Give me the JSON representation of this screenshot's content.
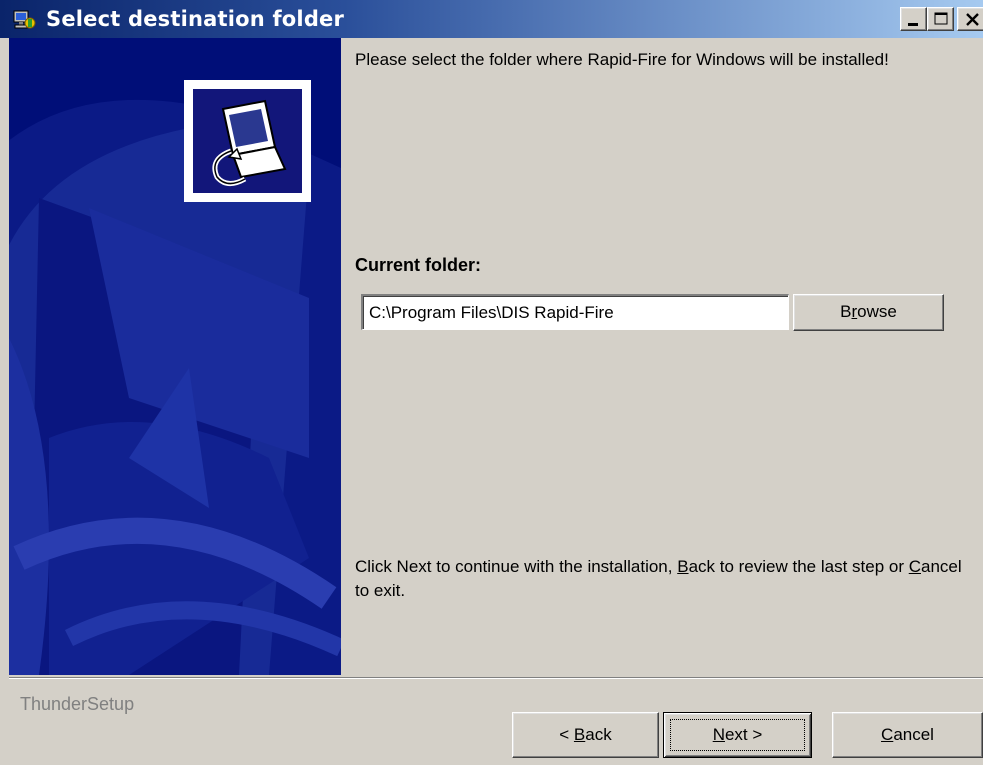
{
  "window": {
    "title": "Select destination folder",
    "title_icon": "installer-icon"
  },
  "caption_buttons": {
    "minimize": "minimize-icon",
    "maximize": "maximize-icon",
    "close": "close-icon"
  },
  "banner": {
    "logo_icon": "computer-setup-icon",
    "background": "#000e78"
  },
  "content": {
    "intro": "Please select the folder where Rapid-Fire for Windows will be installed!",
    "folder_label": "Current folder:",
    "folder_path": "C:\\Program Files\\DIS Rapid-Fire",
    "browse_label": {
      "pre": "B",
      "accel": "r",
      "post": "owse"
    },
    "footer": {
      "part1": "Click Next to continue with the installation, ",
      "back_accel": "B",
      "part2": "ack to review the last step or ",
      "cancel_accel": "C",
      "part3": "ancel to exit."
    }
  },
  "footer_bar": {
    "brand": "ThunderSetup",
    "back_button": {
      "pre": "< ",
      "accel": "B",
      "post": "ack"
    },
    "next_button": {
      "pre": "",
      "accel": "N",
      "post": "ext >"
    },
    "cancel_button": {
      "pre": "",
      "accel": "C",
      "post": "ancel"
    }
  },
  "colors": {
    "titlebar_start": "#0a246a",
    "titlebar_end": "#a6caf0",
    "dialog_face": "#d4d0c8"
  }
}
